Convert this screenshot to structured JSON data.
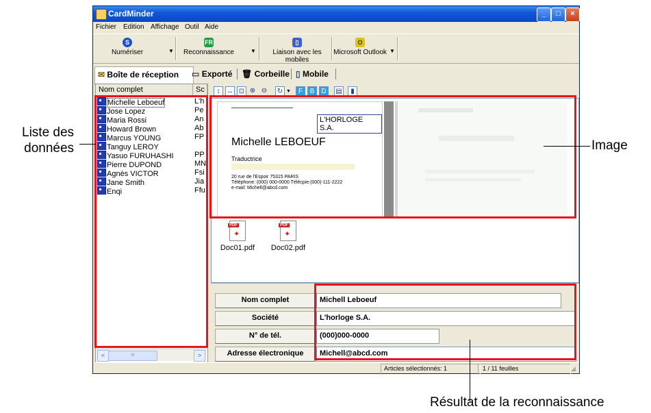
{
  "window": {
    "title": "CardMinder",
    "controls": {
      "minimize": "_",
      "maximize": "□",
      "close": "×"
    }
  },
  "menu": [
    "Fichier",
    "Edition",
    "Affichage",
    "Outil",
    "Aide"
  ],
  "toolbar": {
    "scan_label": "Numériser",
    "recognition_label": "Reconnaissance",
    "mobile_link_label": "Liaison avec les mobiles",
    "outlook_label": "Microsoft Outlook"
  },
  "tabs": {
    "inbox": "Boîte de réception",
    "exported": "Exporté",
    "trash": "Corbeille",
    "mobile": "Mobile"
  },
  "list": {
    "col_name": "Nom complet",
    "col_company": "Sc",
    "rows": [
      {
        "name": "Michelle Leboeuf",
        "company": "L'h"
      },
      {
        "name": "Jose Lopez",
        "company": "Pe"
      },
      {
        "name": "Maria Rossi",
        "company": "An"
      },
      {
        "name": "Howard Brown",
        "company": "Ab"
      },
      {
        "name": "Marcus YOUNG",
        "company": "FP"
      },
      {
        "name": "Tanguy LEROY",
        "company": ""
      },
      {
        "name": "Yasuo FURUHASHI",
        "company": "PP"
      },
      {
        "name": "Pierre DUPOND",
        "company": "MN"
      },
      {
        "name": "Agnès VICTOR",
        "company": "Fsi"
      },
      {
        "name": "Jane Smith",
        "company": "Jia"
      },
      {
        "name": "Enqi",
        "company": "Ffu"
      }
    ],
    "scroll_left": "<",
    "scroll_right": ">",
    "scroll_grip": "III"
  },
  "card": {
    "company": "L'HORLOGE S.A.",
    "name": "Michelle LEBOEUF",
    "title": "Traductrice",
    "address": "20 rue de l'Espoir 75315 PARIS",
    "phone_line": "Téléphone: (000) 000-0000   Télécpie:(000)-111-2222",
    "email_line": "e-mail: Michell@abcd.com"
  },
  "attachments": [
    "Doc01.pdf",
    "Doc02.pdf"
  ],
  "pdf_tag": "PDF",
  "fields": [
    {
      "label": "Nom complet",
      "value": "Michell Leboeuf"
    },
    {
      "label": "Société",
      "value": "L'horloge S.A."
    },
    {
      "label": "N° de tél.",
      "value": "(000)000-0000"
    },
    {
      "label": "Adresse électronique",
      "value": "Michell@abcd.com"
    }
  ],
  "status": {
    "selected": "Articles sélectionnés:   1",
    "pages": "1 /   11 feuilles"
  },
  "callouts": {
    "data_list": [
      "Liste des",
      "données"
    ],
    "image": "Image",
    "result": "Résultat de la reconnaissance"
  },
  "colors": {
    "annotation_red": "#e8141c",
    "titlebar_blue": "#0a48c8"
  }
}
